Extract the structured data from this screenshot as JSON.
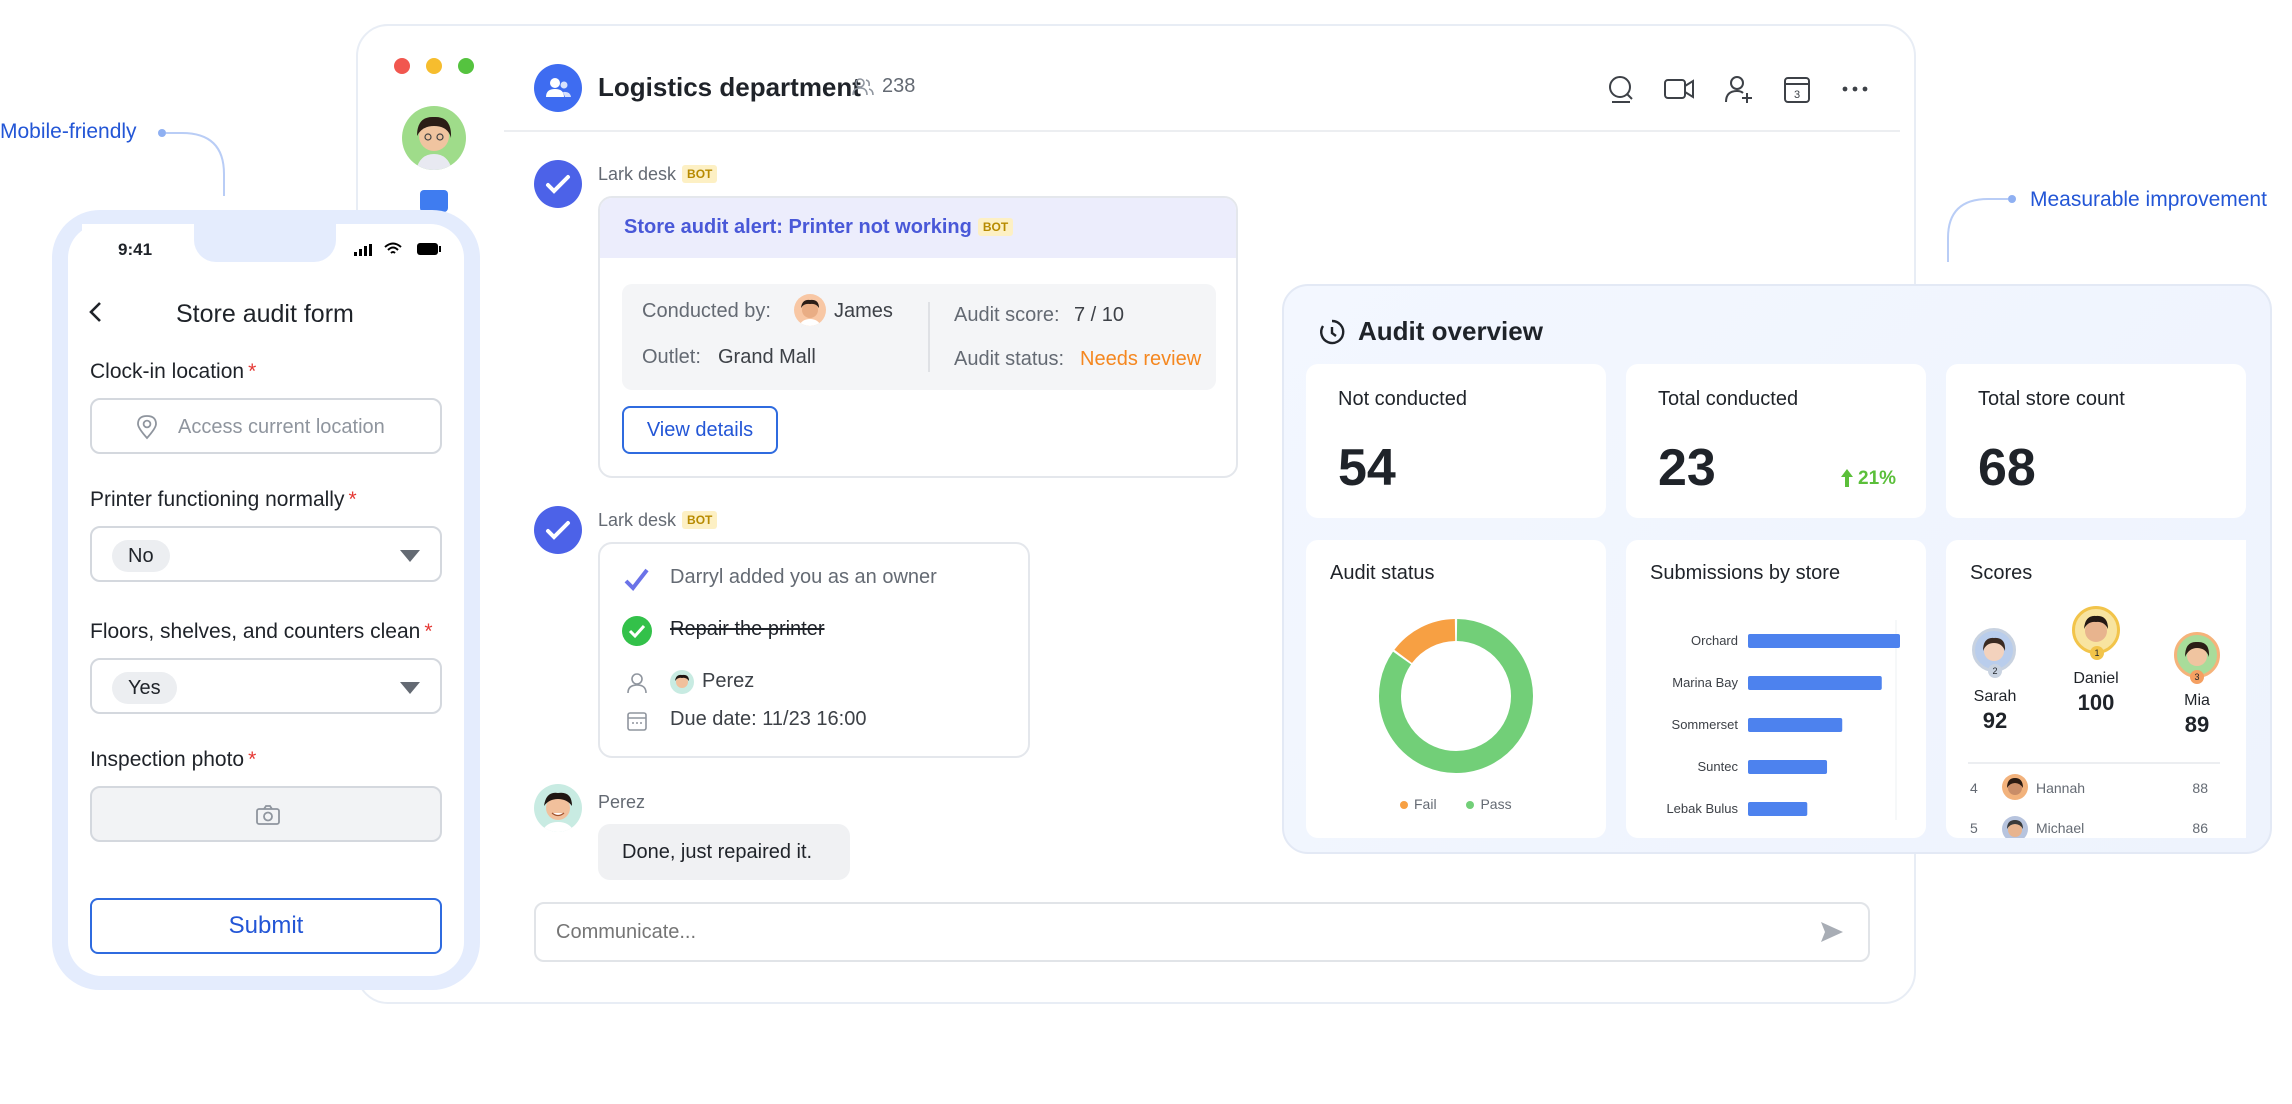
{
  "callouts": {
    "mobile": "Mobile-friendly",
    "measurable": "Measurable improvement"
  },
  "chat": {
    "title": "Logistics department",
    "member_count": "238",
    "header_icons": [
      "search-icon",
      "video-icon",
      "add-member-icon",
      "calendar-icon",
      "more-icon"
    ],
    "messages": {
      "m1": {
        "sender": "Lark desk",
        "tag": "BOT",
        "card_title": "Store audit alert: Printer not working",
        "card_tag": "BOT",
        "conducted_label": "Conducted by:",
        "conducted_by": "James",
        "outlet_label": "Outlet:",
        "outlet": "Grand Mall",
        "score_label": "Audit score:",
        "score": "7 / 10",
        "status_label": "Audit status:",
        "status": "Needs review",
        "button": "View details"
      },
      "m2": {
        "sender": "Lark desk",
        "tag": "BOT",
        "added": "Darryl added you as an owner",
        "task": "Repair the printer",
        "assignee": "Perez",
        "due": "Due date: 11/23 16:00"
      },
      "m3": {
        "sender": "Perez",
        "text": "Done, just repaired it."
      }
    },
    "composer_placeholder": "Communicate..."
  },
  "phone": {
    "time": "9:41",
    "title": "Store audit form",
    "fields": {
      "location_label": "Clock-in location",
      "location_placeholder": "Access current location",
      "printer_label": "Printer functioning normally",
      "printer_value": "No",
      "floors_label": "Floors, shelves, and counters clean",
      "floors_value": "Yes",
      "photo_label": "Inspection photo",
      "required": "*"
    },
    "submit": "Submit"
  },
  "dashboard": {
    "title": "Audit overview",
    "stats": [
      {
        "label": "Not conducted",
        "value": "54"
      },
      {
        "label": "Total conducted",
        "value": "23",
        "delta": "21%"
      },
      {
        "label": "Total store count",
        "value": "68"
      }
    ],
    "audit_status": {
      "title": "Audit status",
      "legend": [
        "Fail",
        "Pass"
      ]
    },
    "submissions": {
      "title": "Submissions by store"
    },
    "scores": {
      "title": "Scores",
      "podium": [
        {
          "name": "Sarah",
          "score": "92",
          "rank": "2"
        },
        {
          "name": "Daniel",
          "score": "100",
          "rank": "1"
        },
        {
          "name": "Mia",
          "score": "89",
          "rank": "3"
        }
      ],
      "list": [
        {
          "rank": "4",
          "name": "Hannah",
          "score": "88"
        },
        {
          "rank": "5",
          "name": "Michael",
          "score": "86"
        }
      ]
    },
    "colors": {
      "fail": "#f7a043",
      "pass": "#72cf78",
      "bar": "#4d82ee",
      "up": "#5bbf3a"
    }
  },
  "chart_data": [
    {
      "type": "pie",
      "title": "Audit status",
      "labels": [
        "Fail",
        "Pass"
      ],
      "values": [
        15,
        85
      ]
    },
    {
      "type": "bar",
      "title": "Submissions by store",
      "categories": [
        "Orchard",
        "Marina Bay",
        "Sommerset",
        "Suntec",
        "Lebak Bulus"
      ],
      "values": [
        100,
        88,
        62,
        52,
        39
      ]
    }
  ]
}
